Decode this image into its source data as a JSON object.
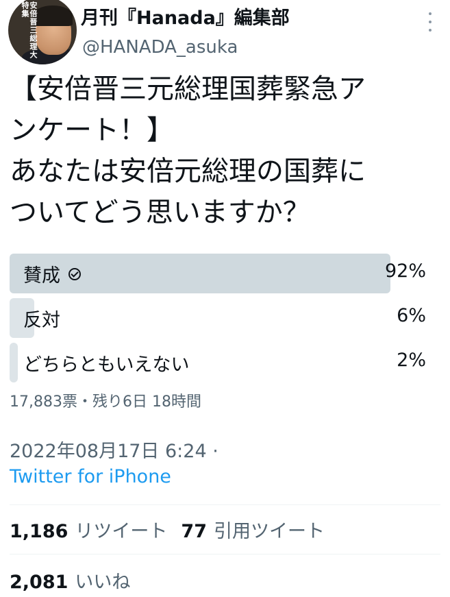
{
  "account": {
    "display_name": "月刊『Hanada』編集部",
    "handle": "@HANADA_asuka",
    "avatar_text": "安倍晋三総理大特集"
  },
  "tweet": {
    "text_lines": [
      "【安倍晋三元総理国葬緊急ア",
      "ンケート！】",
      "あなたは安倍元総理の国葬に",
      "ついてどう思いますか？"
    ]
  },
  "poll": {
    "options": [
      {
        "label": "賛成",
        "percent_text": "92%",
        "percent": 92,
        "winner": true
      },
      {
        "label": "反対",
        "percent_text": "6%",
        "percent": 6,
        "winner": false
      },
      {
        "label": "どちらともいえない",
        "percent_text": "2%",
        "percent": 2,
        "winner": false
      }
    ],
    "meta": "17,883票・残り6日 18時間"
  },
  "timestamp": "2022年08月17日 6:24 ·",
  "source": "Twitter for iPhone",
  "stats": {
    "retweets": "1,186",
    "retweets_label": "リツイート",
    "quotes": "77",
    "quotes_label": "引用ツイート",
    "likes": "2,081",
    "likes_label": "いいね"
  },
  "icons": {
    "more": "more-vertical-icon",
    "check": "check-circle-icon"
  }
}
